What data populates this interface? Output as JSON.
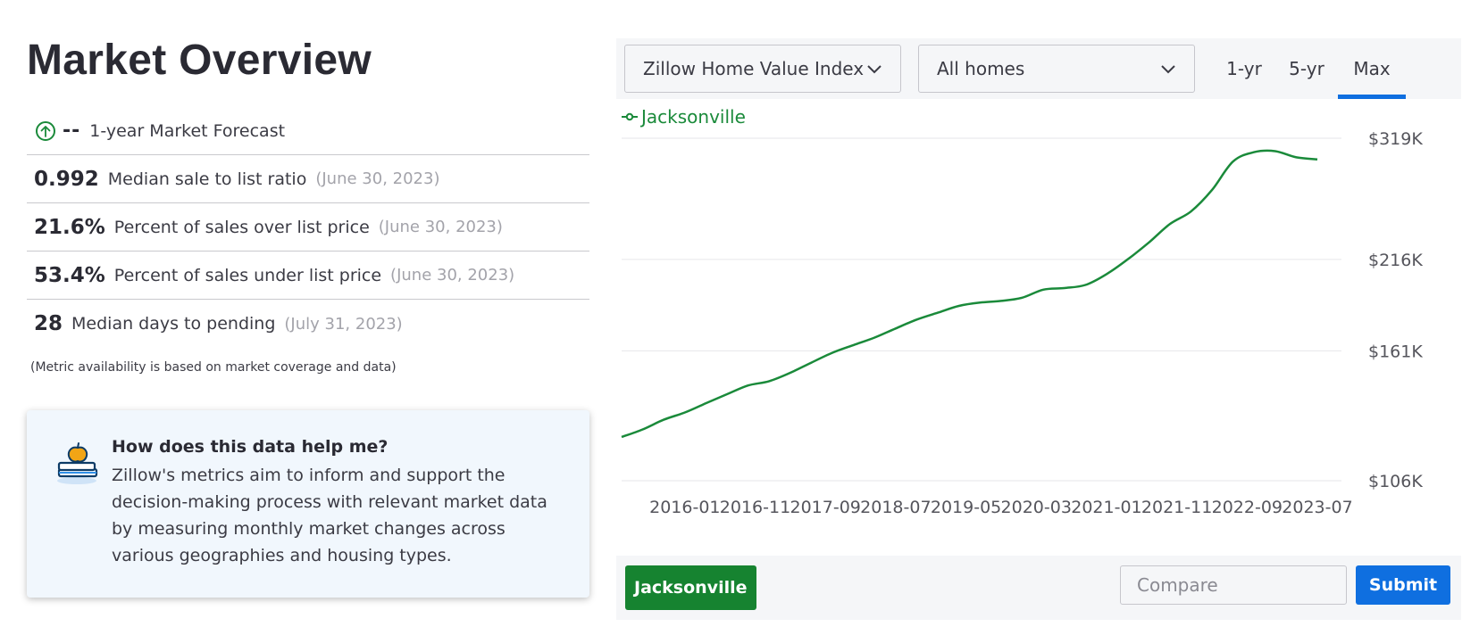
{
  "page": {
    "title": "Market Overview"
  },
  "metrics": [
    {
      "value": "--",
      "label": "1-year Market Forecast",
      "date": ""
    },
    {
      "value": "0.992",
      "label": "Median sale to list ratio",
      "date": "(June 30, 2023)"
    },
    {
      "value": "21.6%",
      "label": "Percent of sales over list price",
      "date": "(June 30, 2023)"
    },
    {
      "value": "53.4%",
      "label": "Percent of sales under list price",
      "date": "(June 30, 2023)"
    },
    {
      "value": "28",
      "label": "Median days to pending",
      "date": "(July 31, 2023)"
    }
  ],
  "metrics_note": "(Metric availability is based on market coverage and data)",
  "help": {
    "title": "How does this data help me?",
    "body": "Zillow's metrics aim to inform and support the decision-making process with relevant market data by measuring monthly market changes across various geographies and housing types.",
    "icon": "book-apple-icon"
  },
  "toolbar": {
    "metric_select": "Zillow Home Value Index",
    "home_type_select": "All homes",
    "ranges": [
      "1-yr",
      "5-yr",
      "Max"
    ],
    "active_range": "Max"
  },
  "bottombar": {
    "location_chip": "Jacksonville",
    "compare_placeholder": "Compare",
    "submit_label": "Submit"
  },
  "colors": {
    "series": "#1a8a3a",
    "accent": "#0f6fe0",
    "chip": "#168330"
  },
  "chart_data": {
    "type": "line",
    "title": "",
    "xlabel": "",
    "ylabel": "",
    "x_ticks": [
      "2016-01",
      "2016-11",
      "2017-09",
      "2018-07",
      "2019-05",
      "2020-03",
      "2021-01",
      "2021-11",
      "2022-09",
      "2023-07"
    ],
    "y_ticks": [
      {
        "value": 106,
        "label": "$106K"
      },
      {
        "value": 161,
        "label": "$161K"
      },
      {
        "value": 216,
        "label": "$216K"
      },
      {
        "value": 319,
        "label": "$319K"
      }
    ],
    "y_scale": "log",
    "ylim": [
      106,
      319
    ],
    "legend": "top-left",
    "grid": true,
    "series": [
      {
        "name": "Jacksonville",
        "x": [
          "2015-04",
          "2015-07",
          "2015-10",
          "2016-01",
          "2016-04",
          "2016-07",
          "2016-10",
          "2017-01",
          "2017-04",
          "2017-07",
          "2017-10",
          "2018-01",
          "2018-04",
          "2018-07",
          "2018-10",
          "2019-01",
          "2019-04",
          "2019-07",
          "2019-10",
          "2020-01",
          "2020-04",
          "2020-07",
          "2020-10",
          "2021-01",
          "2021-04",
          "2021-07",
          "2021-10",
          "2022-01",
          "2022-04",
          "2022-07",
          "2022-10",
          "2023-01",
          "2023-04",
          "2023-07"
        ],
        "values": [
          122,
          125,
          129,
          132,
          136,
          140,
          144,
          146,
          150,
          155,
          160,
          164,
          168,
          173,
          178,
          182,
          186,
          188,
          189,
          191,
          196,
          197,
          199,
          206,
          216,
          228,
          242,
          252,
          270,
          296,
          305,
          306,
          300,
          298
        ]
      }
    ]
  }
}
